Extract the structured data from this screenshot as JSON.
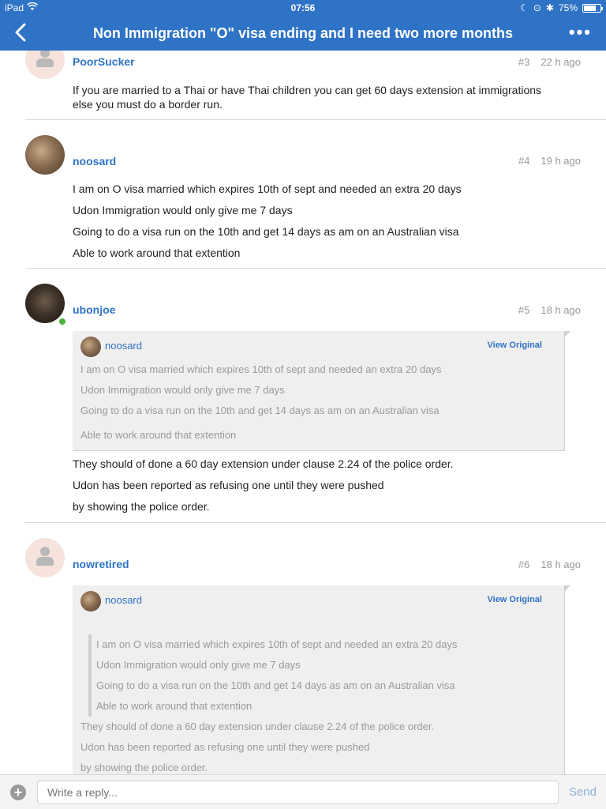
{
  "status_bar": {
    "device": "iPad",
    "time": "07:56",
    "battery": "75%",
    "battery_level": 0.75
  },
  "nav": {
    "title": "Non Immigration \"O\" visa ending and I need two more months"
  },
  "posts": [
    {
      "author": "PoorSucker",
      "number": "#3",
      "time": "22 h ago",
      "lines": [
        "If you are married to a Thai or have Thai children you can get 60 days extension at immigrations",
        "else you must do a border run."
      ]
    },
    {
      "author": "noosard",
      "number": "#4",
      "time": "19 h ago",
      "lines": [
        "I am on O visa married which expires 10th of sept and needed an extra 20 days",
        "Udon Immigration would only give me 7 days",
        "Going to do a visa run on the 10th and get 14 days as am on an Australian visa",
        "Able to work around that extention"
      ]
    },
    {
      "author": "ubonjoe",
      "number": "#5",
      "time": "18 h ago",
      "quote": {
        "author": "noosard",
        "view_label": "View Original",
        "lines": [
          "I am on O visa married which expires 10th of sept and needed an extra 20 days",
          "Udon Immigration would only give me 7 days",
          "Going to do a visa run on the 10th and get 14 days as am on an Australian visa",
          "Able to work around that extention"
        ]
      },
      "lines": [
        "They should of done a 60 day extension under clause 2.24 of the police order.",
        "Udon has been reported as refusing one until they were pushed",
        "by showing the police order."
      ]
    },
    {
      "author": "nowretired",
      "number": "#6",
      "time": "18 h ago",
      "quote": {
        "author": "noosard",
        "view_label": "View Original",
        "nested_lines": [
          "I am on O visa married which expires 10th of sept and needed an extra 20 days",
          "Udon Immigration would only give me 7 days",
          "Going to do a visa run on the 10th and get 14 days as am on an Australian visa",
          "Able to work around that extention"
        ],
        "lines": [
          "They should of done a 60 day extension under clause 2.24 of the police order.",
          "Udon has been reported as refusing one until they were pushed",
          "by showing the police order."
        ]
      }
    }
  ],
  "reply": {
    "placeholder": "Write a reply...",
    "send_label": "Send"
  },
  "colors": {
    "accent": "#2f73c6",
    "online": "#48b13a"
  }
}
